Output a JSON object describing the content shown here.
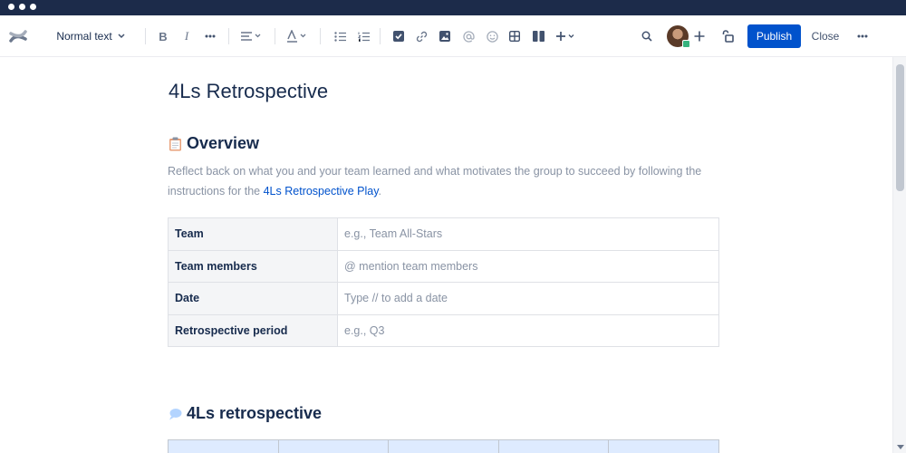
{
  "toolbar": {
    "text_style": "Normal text",
    "publish_label": "Publish",
    "close_label": "Close"
  },
  "page": {
    "title": "4Ls Retrospective",
    "overview_heading": "Overview",
    "overview_text": "Reflect back on what you and your team learned and what motivates the group to succeed by following the instructions for the ",
    "overview_link": "4Ls Retrospective Play",
    "overview_end": ".",
    "info_rows": [
      {
        "label": "Team",
        "placeholder": "e.g., Team All-Stars"
      },
      {
        "label": "Team members",
        "placeholder": "@ mention team members"
      },
      {
        "label": "Date",
        "placeholder": "Type // to add a date"
      },
      {
        "label": "Retrospective period",
        "placeholder": "e.g., Q3"
      }
    ],
    "retro_heading": "4Ls retrospective"
  },
  "icons": {
    "overview_emoji": "clipboard-icon",
    "retro_emoji": "speech-bubble-icon"
  },
  "colors": {
    "titlebar": "#1c2b4a",
    "primary": "#0052cc",
    "text": "#172b4d",
    "placeholder": "#8993a4",
    "header_cell": "#f4f5f7",
    "grid_header": "#deebff"
  }
}
